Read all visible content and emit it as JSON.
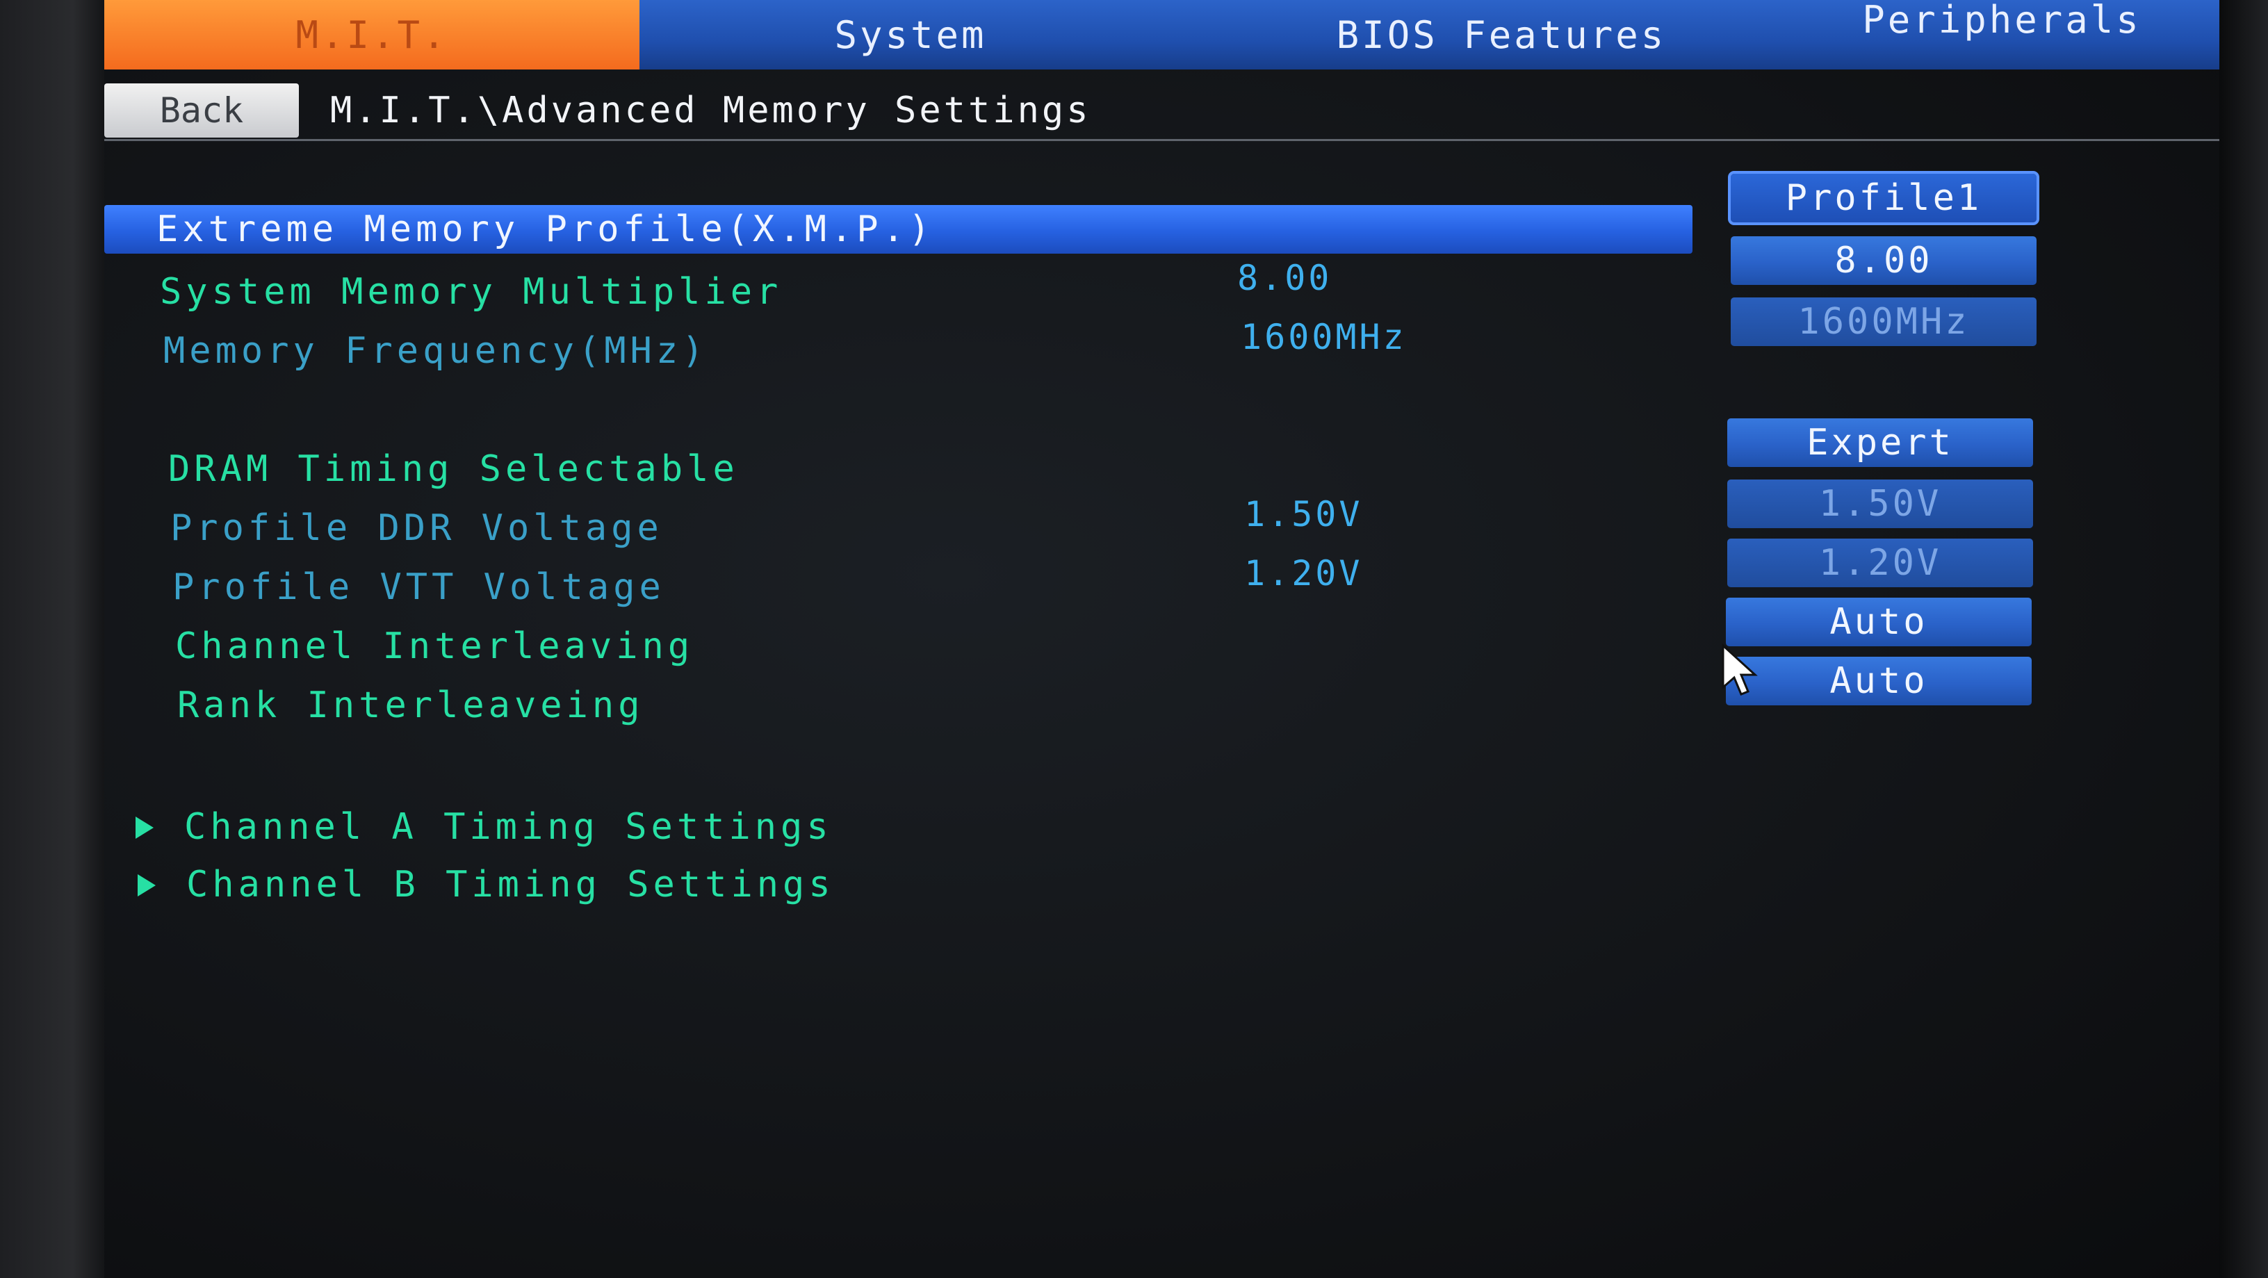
{
  "tabs": {
    "mit": "M.I.T.",
    "system": "System",
    "bios_features": "BIOS Features",
    "peripherals": "Peripherals"
  },
  "nav": {
    "back_label": "Back",
    "breadcrumb": "M.I.T.\\Advanced Memory Settings"
  },
  "settings": {
    "xmp": {
      "label": "Extreme Memory Profile(X.M.P.)",
      "option": "Profile1"
    },
    "multiplier": {
      "label": "System Memory Multiplier",
      "value": "8.00",
      "option": "8.00"
    },
    "frequency": {
      "label": "Memory Frequency(MHz)",
      "value": "1600MHz",
      "option": "1600MHz"
    },
    "dram_timing": {
      "label": "DRAM Timing Selectable",
      "option": "Expert"
    },
    "ddr_voltage": {
      "label": "Profile DDR Voltage",
      "value": "1.50V",
      "option": "1.50V"
    },
    "vtt_voltage": {
      "label": "Profile VTT Voltage",
      "value": "1.20V",
      "option": "1.20V"
    },
    "channel_interleaving": {
      "label": "Channel Interleaving",
      "option": "Auto"
    },
    "rank_interleaving": {
      "label": "Rank Interleaveing",
      "option": "Auto"
    }
  },
  "submenus": [
    {
      "label": "Channel A Timing Settings"
    },
    {
      "label": "Channel B Timing Settings"
    }
  ],
  "colors": {
    "tab_active": "#f46b1e",
    "tab_bar": "#1f4fae",
    "highlight": "#2661e1",
    "label_green": "#27e0a4",
    "value_blue": "#3fb0ee"
  },
  "icons": {
    "submenu_arrow": "triangle-right",
    "pointer": "mouse-cursor"
  }
}
